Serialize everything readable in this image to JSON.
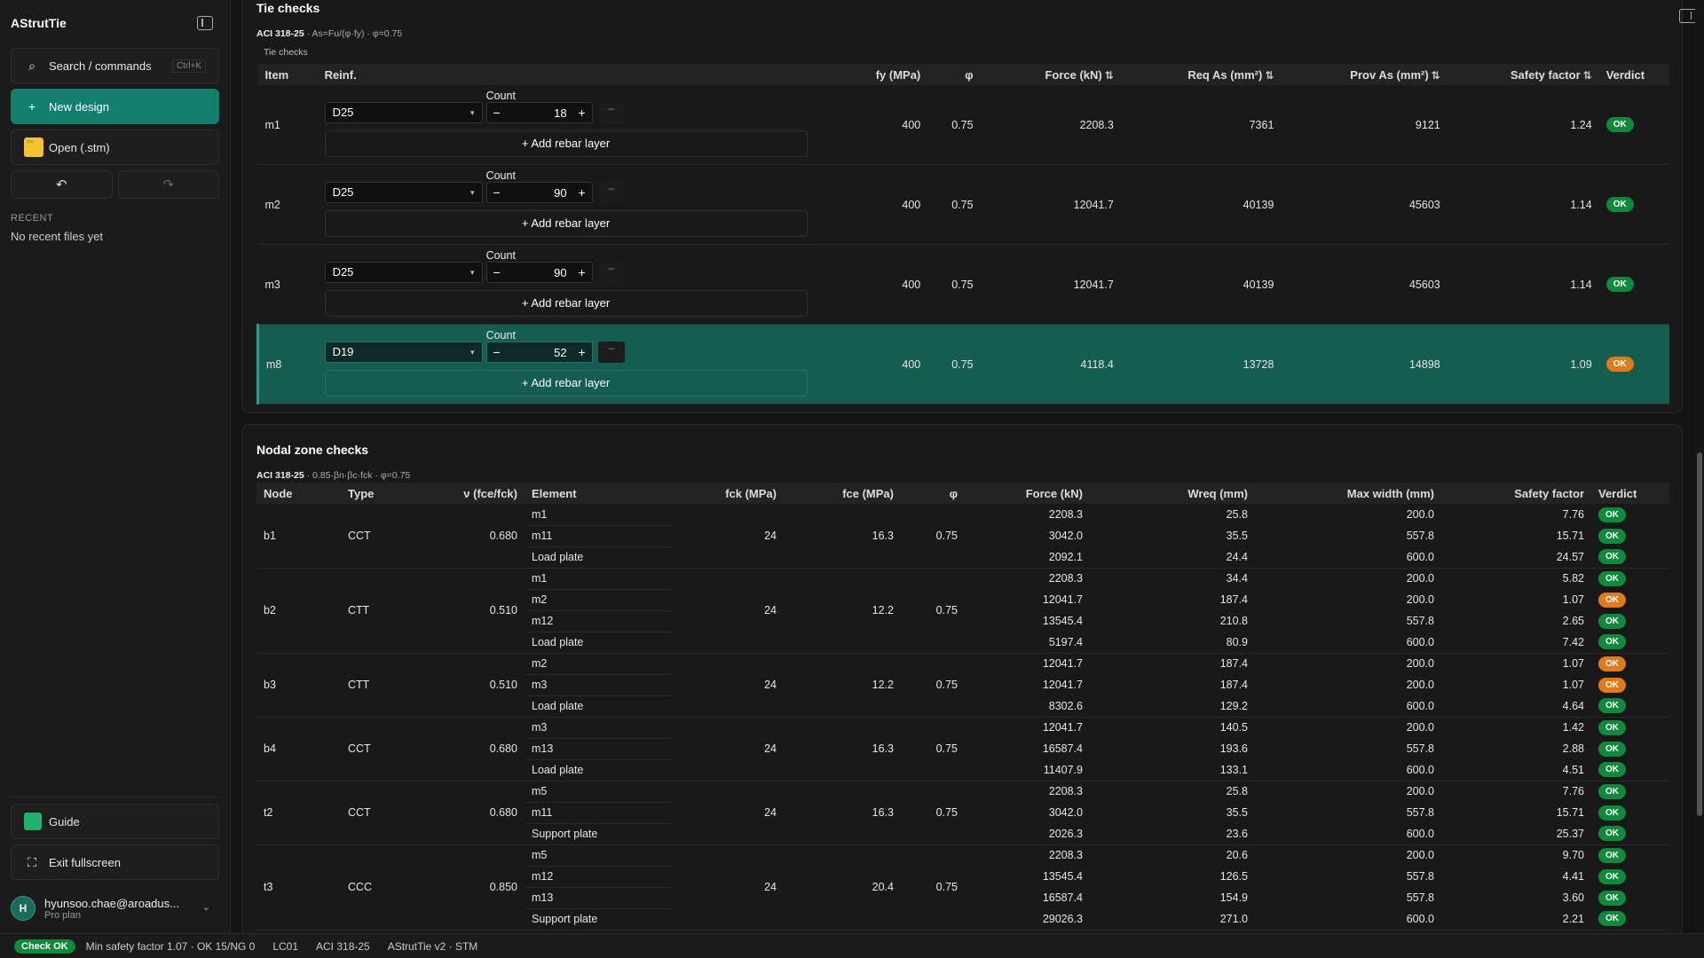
{
  "app": {
    "name": "AStrutTie"
  },
  "sidebar": {
    "search_label": "Search / commands",
    "search_shortcut": "Ctrl+K",
    "new_design_label": "New design",
    "open_label": "Open (.stm)",
    "recent_heading": "RECENT",
    "recent_empty": "No recent files yet",
    "guide_label": "Guide",
    "exit_fullscreen_label": "Exit fullscreen",
    "user": {
      "initial": "H",
      "email": "hyunsoo.chae@aroadus...",
      "plan": "Pro plan"
    }
  },
  "tie": {
    "title": "Tie checks",
    "code": "ACI 318-25",
    "formula": " · As=Fu/(φ·fy) · φ=0.75",
    "caption": "Tie checks",
    "headers": {
      "item": "Item",
      "reinf": "Reinf.",
      "fy": "fy (MPa)",
      "phi": "φ",
      "force": "Force (kN)",
      "req": "Req As (mm²)",
      "prov": "Prov As (mm²)",
      "sf": "Safety factor",
      "verdict": "Verdict"
    },
    "count_label": "Count",
    "add_layer_label": "Add rebar layer",
    "rows": [
      {
        "item": "m1",
        "bar": "D25",
        "count": "18",
        "fy": "400",
        "phi": "0.75",
        "force": "2208.3",
        "req": "7361",
        "prov": "9121",
        "sf": "1.24",
        "verdict": "OK",
        "warn": false
      },
      {
        "item": "m2",
        "bar": "D25",
        "count": "90",
        "fy": "400",
        "phi": "0.75",
        "force": "12041.7",
        "req": "40139",
        "prov": "45603",
        "sf": "1.14",
        "verdict": "OK",
        "warn": false
      },
      {
        "item": "m3",
        "bar": "D25",
        "count": "90",
        "fy": "400",
        "phi": "0.75",
        "force": "12041.7",
        "req": "40139",
        "prov": "45603",
        "sf": "1.14",
        "verdict": "OK",
        "warn": false
      },
      {
        "item": "m8",
        "bar": "D19",
        "count": "52",
        "fy": "400",
        "phi": "0.75",
        "force": "4118.4",
        "req": "13728",
        "prov": "14898",
        "sf": "1.09",
        "verdict": "OK",
        "warn": true
      }
    ]
  },
  "nodal": {
    "title": "Nodal zone checks",
    "code": "ACI 318-25",
    "formula": " · 0.85·βn·βc·fck · φ=0.75",
    "headers": {
      "node": "Node",
      "type": "Type",
      "nu": "ν (fce/fck)",
      "element": "Element",
      "fck": "fck (MPa)",
      "fce": "fce (MPa)",
      "phi": "φ",
      "force": "Force (kN)",
      "wreq": "Wreq (mm)",
      "maxw": "Max width (mm)",
      "sf": "Safety factor",
      "verdict": "Verdict"
    },
    "groups": [
      {
        "node": "b1",
        "type": "CCT",
        "nu": "0.680",
        "fck": "24",
        "fce": "16.3",
        "phi": "0.75",
        "rows": [
          {
            "el": "m1",
            "force": "2208.3",
            "wreq": "25.8",
            "maxw": "200.0",
            "sf": "7.76",
            "v": "OK",
            "warn": false
          },
          {
            "el": "m11",
            "force": "3042.0",
            "wreq": "35.5",
            "maxw": "557.8",
            "sf": "15.71",
            "v": "OK",
            "warn": false
          },
          {
            "el": "Load plate",
            "force": "2092.1",
            "wreq": "24.4",
            "maxw": "600.0",
            "sf": "24.57",
            "v": "OK",
            "warn": false
          }
        ]
      },
      {
        "node": "b2",
        "type": "CTT",
        "nu": "0.510",
        "fck": "24",
        "fce": "12.2",
        "phi": "0.75",
        "rows": [
          {
            "el": "m1",
            "force": "2208.3",
            "wreq": "34.4",
            "maxw": "200.0",
            "sf": "5.82",
            "v": "OK",
            "warn": false
          },
          {
            "el": "m2",
            "force": "12041.7",
            "wreq": "187.4",
            "maxw": "200.0",
            "sf": "1.07",
            "v": "OK",
            "warn": true
          },
          {
            "el": "m12",
            "force": "13545.4",
            "wreq": "210.8",
            "maxw": "557.8",
            "sf": "2.65",
            "v": "OK",
            "warn": false
          },
          {
            "el": "Load plate",
            "force": "5197.4",
            "wreq": "80.9",
            "maxw": "600.0",
            "sf": "7.42",
            "v": "OK",
            "warn": false
          }
        ]
      },
      {
        "node": "b3",
        "type": "CTT",
        "nu": "0.510",
        "fck": "24",
        "fce": "12.2",
        "phi": "0.75",
        "rows": [
          {
            "el": "m2",
            "force": "12041.7",
            "wreq": "187.4",
            "maxw": "200.0",
            "sf": "1.07",
            "v": "OK",
            "warn": true
          },
          {
            "el": "m3",
            "force": "12041.7",
            "wreq": "187.4",
            "maxw": "200.0",
            "sf": "1.07",
            "v": "OK",
            "warn": true
          },
          {
            "el": "Load plate",
            "force": "8302.6",
            "wreq": "129.2",
            "maxw": "600.0",
            "sf": "4.64",
            "v": "OK",
            "warn": false
          }
        ]
      },
      {
        "node": "b4",
        "type": "CCT",
        "nu": "0.680",
        "fck": "24",
        "fce": "16.3",
        "phi": "0.75",
        "rows": [
          {
            "el": "m3",
            "force": "12041.7",
            "wreq": "140.5",
            "maxw": "200.0",
            "sf": "1.42",
            "v": "OK",
            "warn": false
          },
          {
            "el": "m13",
            "force": "16587.4",
            "wreq": "193.6",
            "maxw": "557.8",
            "sf": "2.88",
            "v": "OK",
            "warn": false
          },
          {
            "el": "Load plate",
            "force": "11407.9",
            "wreq": "133.1",
            "maxw": "600.0",
            "sf": "4.51",
            "v": "OK",
            "warn": false
          }
        ]
      },
      {
        "node": "t2",
        "type": "CCT",
        "nu": "0.680",
        "fck": "24",
        "fce": "16.3",
        "phi": "0.75",
        "rows": [
          {
            "el": "m5",
            "force": "2208.3",
            "wreq": "25.8",
            "maxw": "200.0",
            "sf": "7.76",
            "v": "OK",
            "warn": false
          },
          {
            "el": "m11",
            "force": "3042.0",
            "wreq": "35.5",
            "maxw": "557.8",
            "sf": "15.71",
            "v": "OK",
            "warn": false
          },
          {
            "el": "Support plate",
            "force": "2026.3",
            "wreq": "23.6",
            "maxw": "600.0",
            "sf": "25.37",
            "v": "OK",
            "warn": false
          }
        ]
      },
      {
        "node": "t3",
        "type": "CCC",
        "nu": "0.850",
        "fck": "24",
        "fce": "20.4",
        "phi": "0.75",
        "rows": [
          {
            "el": "m5",
            "force": "2208.3",
            "wreq": "20.6",
            "maxw": "200.0",
            "sf": "9.70",
            "v": "OK",
            "warn": false
          },
          {
            "el": "m12",
            "force": "13545.4",
            "wreq": "126.5",
            "maxw": "557.8",
            "sf": "4.41",
            "v": "OK",
            "warn": false
          },
          {
            "el": "m13",
            "force": "16587.4",
            "wreq": "154.9",
            "maxw": "557.8",
            "sf": "3.60",
            "v": "OK",
            "warn": false
          },
          {
            "el": "Support plate",
            "force": "29026.3",
            "wreq": "271.0",
            "maxw": "600.0",
            "sf": "2.21",
            "v": "OK",
            "warn": false
          }
        ]
      }
    ]
  },
  "status": {
    "badge": "Check OK",
    "summary": "Min safety factor 1.07 · OK 15/NG 0",
    "load_case": "LC01",
    "code": "ACI 318-25",
    "version": "AStrutTie v2 · STM"
  },
  "colors": {
    "accent": "#13806f",
    "selected_row": "#155c51",
    "ok": "#0f8a3c",
    "warn": "#e07a1a"
  }
}
